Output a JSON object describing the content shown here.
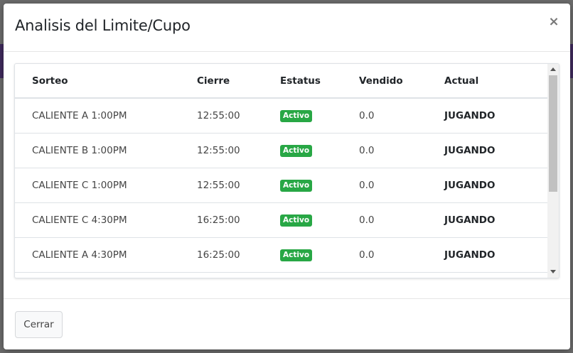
{
  "modal": {
    "title": "Analisis del Limite/Cupo",
    "close_symbol": "×",
    "close_icon": "close-icon"
  },
  "table": {
    "headers": {
      "sorteo": "Sorteo",
      "cierre": "Cierre",
      "estatus": "Estatus",
      "vendido": "Vendido",
      "actual": "Actual"
    },
    "rows": [
      {
        "sorteo": "CALIENTE A 1:00PM",
        "cierre": "12:55:00",
        "estatus": "Activo",
        "vendido": "0.0",
        "actual": "JUGANDO"
      },
      {
        "sorteo": "CALIENTE B 1:00PM",
        "cierre": "12:55:00",
        "estatus": "Activo",
        "vendido": "0.0",
        "actual": "JUGANDO"
      },
      {
        "sorteo": "CALIENTE C 1:00PM",
        "cierre": "12:55:00",
        "estatus": "Activo",
        "vendido": "0.0",
        "actual": "JUGANDO"
      },
      {
        "sorteo": "CALIENTE C 4:30PM",
        "cierre": "16:25:00",
        "estatus": "Activo",
        "vendido": "0.0",
        "actual": "JUGANDO"
      },
      {
        "sorteo": "CALIENTE A 4:30PM",
        "cierre": "16:25:00",
        "estatus": "Activo",
        "vendido": "0.0",
        "actual": "JUGANDO"
      },
      {
        "sorteo": "",
        "cierre": "",
        "estatus": "",
        "vendido": "",
        "actual": ""
      }
    ]
  },
  "footer": {
    "close_button_label": "Cerrar"
  },
  "colors": {
    "badge_active": "#28a745",
    "backdrop": "#6b6b6b"
  }
}
